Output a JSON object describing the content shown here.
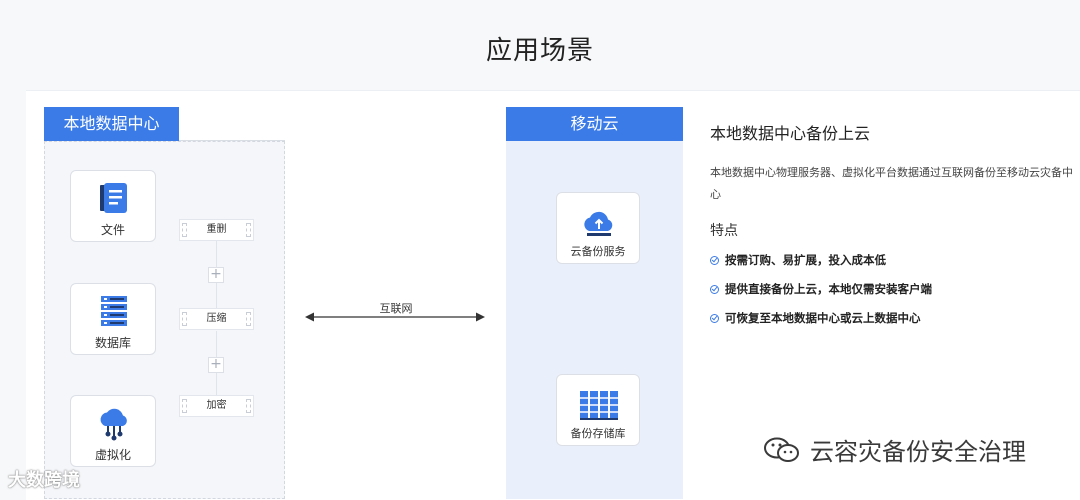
{
  "page": {
    "title": "应用场景"
  },
  "local": {
    "header": "本地数据中心",
    "sources": [
      {
        "label": "文件",
        "icon": "document-icon"
      },
      {
        "label": "数据库",
        "icon": "database-icon"
      },
      {
        "label": "虚拟化",
        "icon": "cloud-network-icon"
      }
    ],
    "steps": [
      {
        "label": "重删"
      },
      {
        "label": "压缩"
      },
      {
        "label": "加密"
      }
    ]
  },
  "network": {
    "label": "互联网",
    "icon": "bidirectional-arrow-icon"
  },
  "cloud": {
    "header": "移动云",
    "services": [
      {
        "label": "云备份服务",
        "icon": "cloud-upload-icon"
      },
      {
        "label": "备份存储库",
        "icon": "storage-rack-icon"
      }
    ]
  },
  "detail": {
    "title": "本地数据中心备份上云",
    "description": "本地数据中心物理服务器、虚拟化平台数据通过互联网备份至移动云灾备中心",
    "features_title": "特点",
    "features": [
      "按需订购、易扩展，投入成本低",
      "提供直接备份上云，本地仅需安装客户端",
      "可恢复至本地数据中心或云上数据中心"
    ]
  },
  "watermarks": {
    "left": "大数跨境",
    "right": "云容灾备份安全治理"
  },
  "colors": {
    "accent": "#3b7be8",
    "cloud_bg": "#eaf0fb",
    "local_bg": "#f4f6f9"
  }
}
